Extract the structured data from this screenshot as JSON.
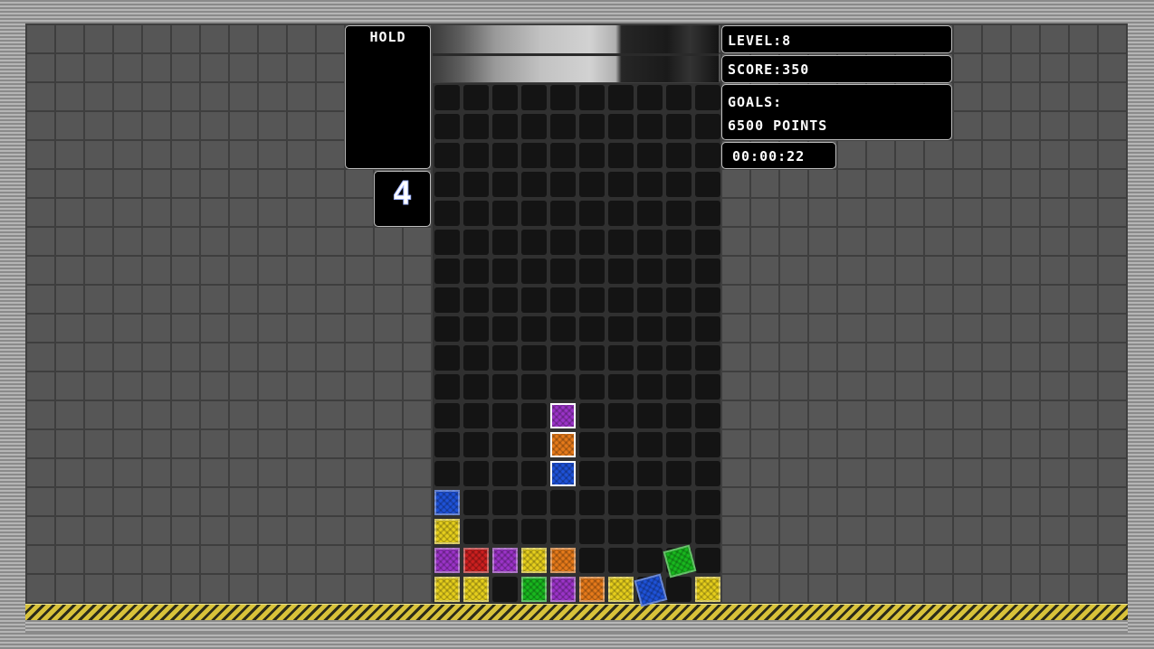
{
  "hud": {
    "hold_label": "HOLD",
    "next_count": "4",
    "level_text": "LEVEL:8",
    "score_text": "SCORE:350",
    "goals_label": "GOALS:",
    "goals_value": "6500 POINTS",
    "timer": "00:00:22"
  },
  "colors": {
    "blue": "#1e52d8",
    "yellow": "#e6cf1c",
    "purple": "#9b33c8",
    "red": "#cc1f1f",
    "orange": "#e67a1a",
    "green": "#18b81e"
  },
  "board": {
    "columns": 10,
    "rows": 18,
    "settled_blocks": [
      {
        "col": 0,
        "row": 14,
        "color": "blue"
      },
      {
        "col": 0,
        "row": 15,
        "color": "yellow"
      },
      {
        "col": 0,
        "row": 16,
        "color": "purple"
      },
      {
        "col": 1,
        "row": 16,
        "color": "red"
      },
      {
        "col": 2,
        "row": 16,
        "color": "purple"
      },
      {
        "col": 3,
        "row": 16,
        "color": "yellow"
      },
      {
        "col": 4,
        "row": 16,
        "color": "orange"
      },
      {
        "col": 0,
        "row": 17,
        "color": "yellow"
      },
      {
        "col": 1,
        "row": 17,
        "color": "yellow"
      },
      {
        "col": 3,
        "row": 17,
        "color": "green"
      },
      {
        "col": 4,
        "row": 17,
        "color": "purple"
      },
      {
        "col": 5,
        "row": 17,
        "color": "orange"
      },
      {
        "col": 6,
        "row": 17,
        "color": "yellow"
      },
      {
        "col": 9,
        "row": 17,
        "color": "yellow"
      }
    ],
    "active_piece": [
      {
        "col": 4,
        "row": 11,
        "color": "purple"
      },
      {
        "col": 4,
        "row": 12,
        "color": "orange"
      },
      {
        "col": 4,
        "row": 13,
        "color": "blue"
      }
    ],
    "tumbling_blocks": [
      {
        "col": 7,
        "row": 17,
        "color": "blue",
        "rotation": -15
      },
      {
        "col": 8,
        "row": 16,
        "color": "green",
        "rotation": -15
      }
    ]
  }
}
